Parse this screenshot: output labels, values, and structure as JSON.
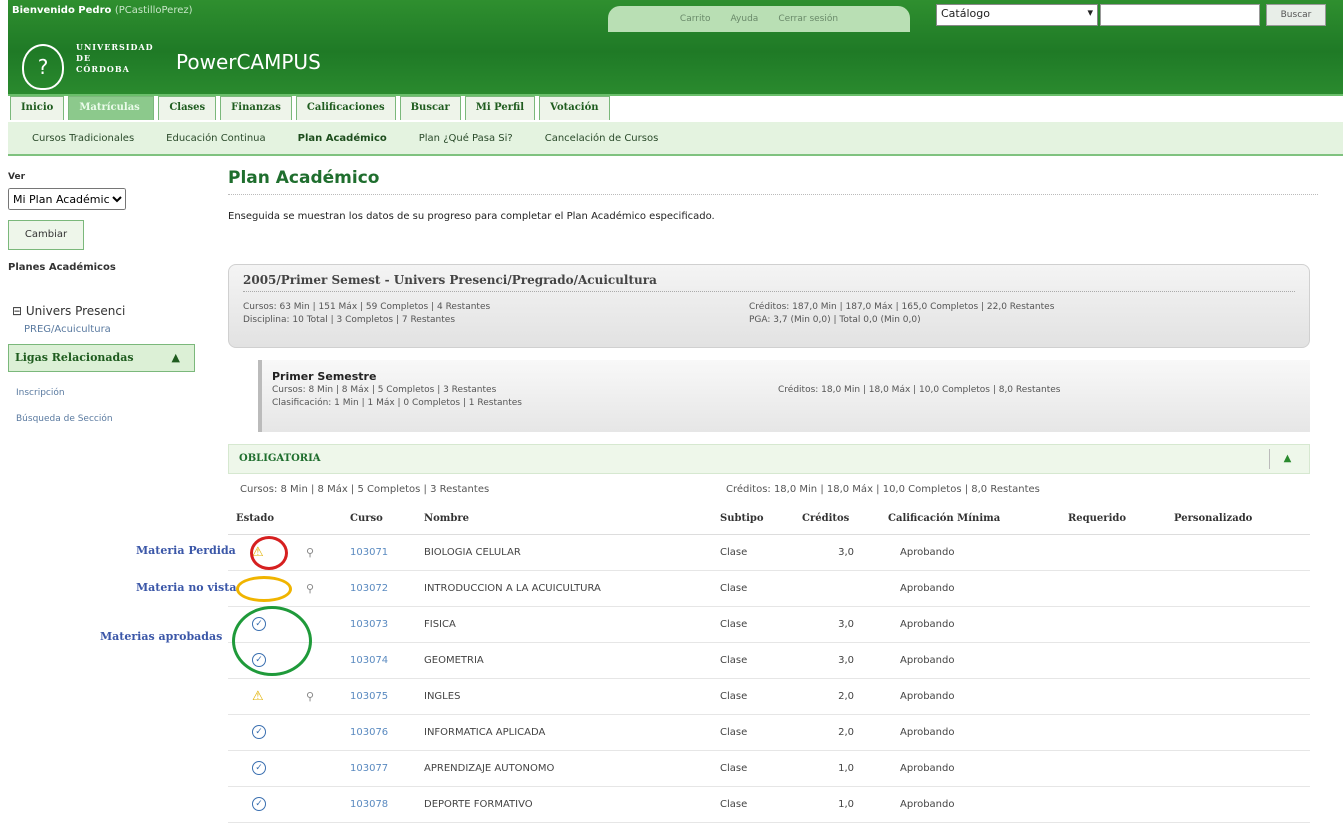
{
  "header": {
    "welcome": "Bienvenido Pedro",
    "user": "(PCastilloPerez)",
    "links": [
      "Carrito",
      "Ayuda",
      "Cerrar sesión"
    ],
    "catalog": "Catálogo",
    "search_btn": "Buscar",
    "uni_line1": "UNIVERSIDAD",
    "uni_line2": "DE",
    "uni_line3": "CÓRDOBA",
    "app": "PowerCAMPUS"
  },
  "tabs": [
    "Inicio",
    "Matrículas",
    "Clases",
    "Finanzas",
    "Calificaciones",
    "Buscar",
    "Mi Perfil",
    "Votación"
  ],
  "subnav": [
    "Cursos Tradicionales",
    "Educación Continua",
    "Plan Académico",
    "Plan ¿Qué Pasa Si?",
    "Cancelación de Cursos"
  ],
  "sidebar": {
    "ver": "Ver",
    "select": "Mi Plan Académico",
    "button": "Cambiar",
    "planes": "Planes Académicos",
    "univ": "Univers Presenci",
    "preg": "PREG/Acuicultura",
    "ligas": "Ligas Relacionadas",
    "links": [
      "Inscripción",
      "Búsqueda de Sección"
    ]
  },
  "main": {
    "title": "Plan Académico",
    "desc": "Enseguida se muestran los datos de su progreso para completar el Plan Académico especificado.",
    "plan": {
      "title": "2005/Primer Semest - Univers Presenci/Pregrado/Acuicultura",
      "l1": "Cursos: 63 Min | 151 Máx | 59 Completos | 4 Restantes",
      "l2": "Disciplina: 10 Total | 3 Completos | 7 Restantes",
      "r1": "Créditos: 187,0 Min | 187,0 Máx | 165,0 Completos | 22,0 Restantes",
      "r2": "PGA: 3,7 (Min 0,0) | Total 0,0 (Min 0,0)"
    },
    "sem": {
      "title": "Primer Semestre",
      "l1": "Cursos: 8 Min | 8 Máx | 5 Completos | 3 Restantes",
      "l2": "Clasificación: 1 Min | 1 Máx | 0 Completos | 1 Restantes",
      "r1": "Créditos: 18,0 Min | 18,0 Máx | 10,0 Completos | 8,0 Restantes"
    },
    "obl": "OBLIGATORIA",
    "sum_l": "Cursos: 8 Min | 8 Máx | 5 Completos | 3 Restantes",
    "sum_r": "Créditos: 18,0 Min | 18,0 Máx | 10,0 Completos | 8,0 Restantes",
    "cols": [
      "Estado",
      "",
      "Curso",
      "Nombre",
      "Subtipo",
      "Créditos",
      "Calificación Mínima",
      "Requerido",
      "Personalizado"
    ]
  },
  "rows": [
    {
      "estado": "warn",
      "mag": true,
      "curso": "103071",
      "nombre": "BIOLOGIA CELULAR",
      "subtipo": "Clase",
      "cred": "3,0",
      "cal": "Aprobando"
    },
    {
      "estado": "none",
      "mag": true,
      "curso": "103072",
      "nombre": "INTRODUCCION A LA ACUICULTURA",
      "subtipo": "Clase",
      "cred": "",
      "cal": "Aprobando"
    },
    {
      "estado": "ok",
      "mag": false,
      "curso": "103073",
      "nombre": "FISICA",
      "subtipo": "Clase",
      "cred": "3,0",
      "cal": "Aprobando"
    },
    {
      "estado": "ok",
      "mag": false,
      "curso": "103074",
      "nombre": "GEOMETRIA",
      "subtipo": "Clase",
      "cred": "3,0",
      "cal": "Aprobando"
    },
    {
      "estado": "warn",
      "mag": true,
      "curso": "103075",
      "nombre": "INGLES",
      "subtipo": "Clase",
      "cred": "2,0",
      "cal": "Aprobando"
    },
    {
      "estado": "ok",
      "mag": false,
      "curso": "103076",
      "nombre": "INFORMATICA APLICADA",
      "subtipo": "Clase",
      "cred": "2,0",
      "cal": "Aprobando"
    },
    {
      "estado": "ok",
      "mag": false,
      "curso": "103077",
      "nombre": "APRENDIZAJE AUTONOMO",
      "subtipo": "Clase",
      "cred": "1,0",
      "cal": "Aprobando"
    },
    {
      "estado": "ok",
      "mag": false,
      "curso": "103078",
      "nombre": "DEPORTE FORMATIVO",
      "subtipo": "Clase",
      "cred": "1,0",
      "cal": "Aprobando"
    }
  ],
  "annotations": {
    "perdida": "Materia Perdida",
    "novista": "Materia no vista",
    "aprobadas": "Materias aprobadas"
  },
  "colors": {
    "red": "#d62020",
    "yellow": "#f0b400",
    "green": "#1f9a3a"
  }
}
